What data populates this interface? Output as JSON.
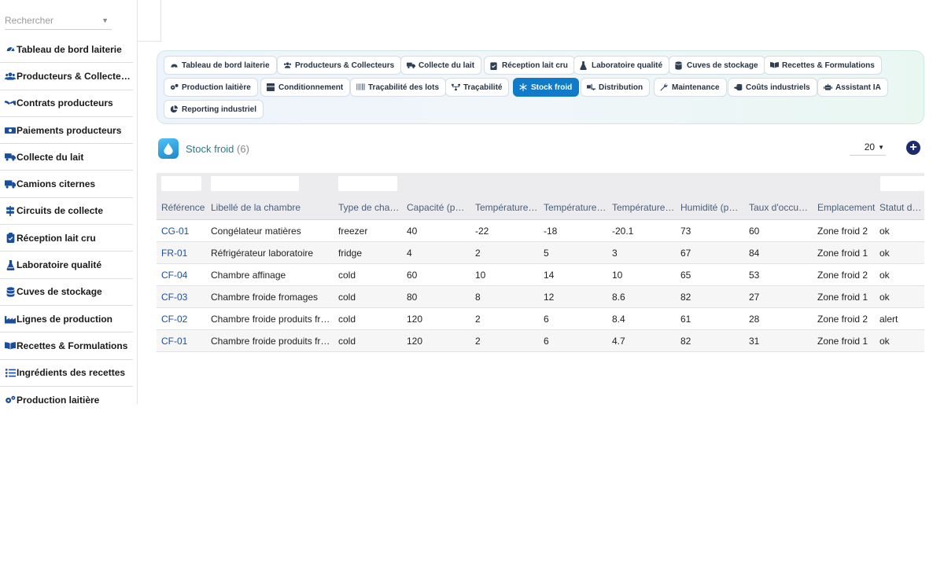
{
  "sidebar": {
    "search_placeholder": "Rechercher",
    "items": [
      {
        "label": "Tableau de bord laiterie",
        "icon": "gauge-icon"
      },
      {
        "label": "Producteurs & Collecteurs",
        "icon": "users-icon"
      },
      {
        "label": "Contrats producteurs",
        "icon": "handshake-icon"
      },
      {
        "label": "Paiements producteurs",
        "icon": "money-bill-icon"
      },
      {
        "label": "Collecte du lait",
        "icon": "truck-icon"
      },
      {
        "label": "Camions citernes",
        "icon": "truck-moving-icon"
      },
      {
        "label": "Circuits de collecte",
        "icon": "signs-icon"
      },
      {
        "label": "Réception lait cru",
        "icon": "clipboard-check-icon"
      },
      {
        "label": "Laboratoire qualité",
        "icon": "flask-icon"
      },
      {
        "label": "Cuves de stockage",
        "icon": "database-icon"
      },
      {
        "label": "Lignes de production",
        "icon": "industry-icon"
      },
      {
        "label": "Recettes & Formulations",
        "icon": "book-open-icon"
      },
      {
        "label": "Ingrédients des recettes",
        "icon": "list-icon"
      },
      {
        "label": "Production laitière",
        "icon": "cogs-icon"
      }
    ]
  },
  "nav": {
    "chips": [
      {
        "label": "Tableau de bord laiterie",
        "icon": "gauge-icon"
      },
      {
        "label": "Producteurs & Collecteurs",
        "icon": "users-icon"
      },
      {
        "label": "Collecte du lait",
        "icon": "truck-icon"
      },
      {
        "label": "Réception lait cru",
        "icon": "clipboard-check-icon"
      },
      {
        "label": "Laboratoire qualité",
        "icon": "flask-icon"
      },
      {
        "label": "Cuves de stockage",
        "icon": "database-icon"
      },
      {
        "label": "Recettes & Formulations",
        "icon": "book-open-icon"
      },
      {
        "label": "Production laitière",
        "icon": "cogs-icon"
      },
      {
        "label": "Conditionnement",
        "icon": "box-icon"
      },
      {
        "label": "Traçabilité des lots",
        "icon": "barcode-icon"
      },
      {
        "label": "Traçabilité",
        "icon": "sitemap-icon"
      },
      {
        "label": "Stock froid",
        "icon": "snowflake-icon"
      },
      {
        "label": "Distribution",
        "icon": "truck-loading-icon"
      },
      {
        "label": "Maintenance",
        "icon": "wrench-icon"
      },
      {
        "label": "Coûts industriels",
        "icon": "coins-icon"
      },
      {
        "label": "Assistant IA",
        "icon": "robot-icon"
      },
      {
        "label": "Reporting industriel",
        "icon": "chart-pie-icon"
      }
    ],
    "active": "Stock froid"
  },
  "header": {
    "title": "Stock froid",
    "count": "(6)",
    "page_size": "20",
    "add_label": "+"
  },
  "table": {
    "columns": [
      "Référence",
      "Libellé de la chambre",
      "Type de cha…",
      "Capacité (pa…",
      "Température…",
      "Température…",
      "Température…",
      "Humidité (po…",
      "Taux d'occu…",
      "Emplacement",
      "Statut de la"
    ],
    "rows": [
      [
        "CG-01",
        "Congélateur matières",
        "freezer",
        "40",
        "-22",
        "-18",
        "-20.1",
        "73",
        "60",
        "Zone froid 2",
        "ok"
      ],
      [
        "FR-01",
        "Réfrigérateur laboratoire",
        "fridge",
        "4",
        "2",
        "5",
        "3",
        "67",
        "84",
        "Zone froid 1",
        "ok"
      ],
      [
        "CF-04",
        "Chambre affinage",
        "cold",
        "60",
        "10",
        "14",
        "10",
        "65",
        "53",
        "Zone froid 2",
        "ok"
      ],
      [
        "CF-03",
        "Chambre froide fromages",
        "cold",
        "80",
        "8",
        "12",
        "8.6",
        "82",
        "27",
        "Zone froid 1",
        "ok"
      ],
      [
        "CF-02",
        "Chambre froide produits frais",
        "cold",
        "120",
        "2",
        "6",
        "8.4",
        "61",
        "28",
        "Zone froid 2",
        "alert"
      ],
      [
        "CF-01",
        "Chambre froide produits frais",
        "cold",
        "120",
        "2",
        "6",
        "4.7",
        "82",
        "31",
        "Zone froid 1",
        "ok"
      ]
    ]
  },
  "colors": {
    "accent": "#0f7bc9",
    "title": "#1f7f8a",
    "link": "#1f4fa0",
    "add_button": "#1d2a6b"
  }
}
